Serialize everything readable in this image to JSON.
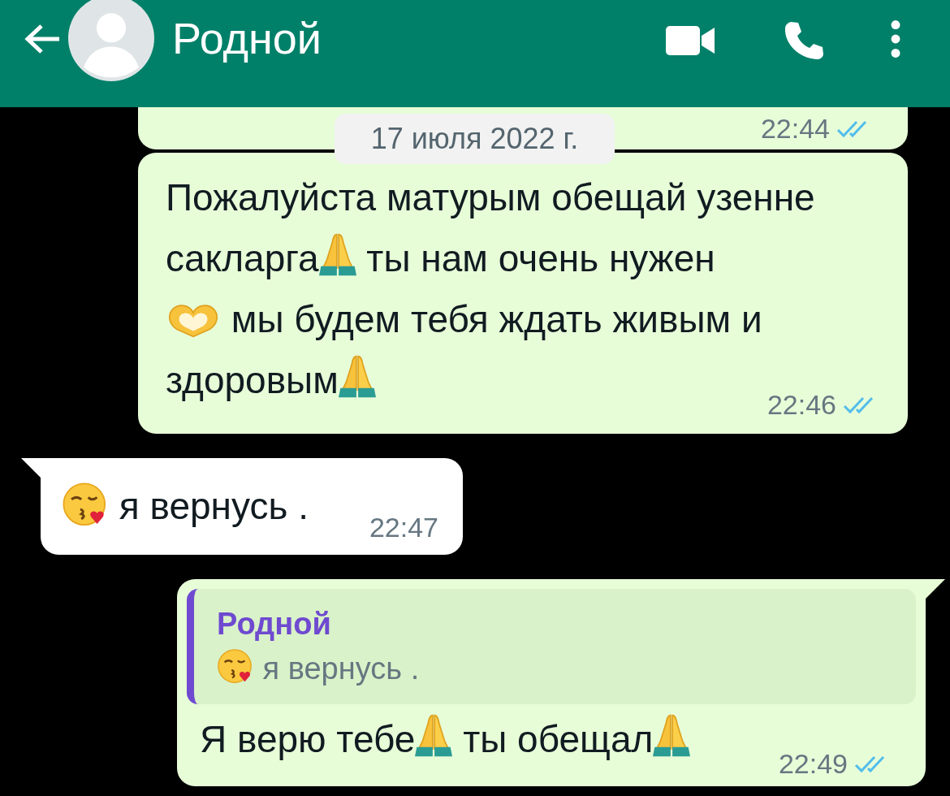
{
  "header": {
    "title": "Родной"
  },
  "date_separator": "17 июля 2022 г.",
  "messages": [
    {
      "kind": "outgoing",
      "time": "22:44",
      "read": true
    },
    {
      "kind": "outgoing",
      "time": "22:46",
      "read": true,
      "lines": [
        [
          {
            "kind": "text",
            "text": "Пожалуйста матурым обещай узенне"
          }
        ],
        [
          {
            "kind": "text",
            "text": "сакларга"
          },
          {
            "kind": "pray"
          },
          {
            "kind": "text",
            "text": " ты нам очень нужен"
          }
        ],
        [
          {
            "kind": "heart-hands"
          },
          {
            "kind": "text",
            "text": " мы будем тебя ждать живым и"
          }
        ],
        [
          {
            "kind": "text",
            "text": "здоровым"
          },
          {
            "kind": "pray"
          }
        ]
      ]
    },
    {
      "kind": "incoming",
      "time": "22:47",
      "lines": [
        [
          {
            "kind": "kiss"
          },
          {
            "kind": "text",
            "text": " я вернусь ."
          }
        ]
      ]
    },
    {
      "kind": "outgoing",
      "time": "22:49",
      "read": true,
      "reply": {
        "author": "Родной",
        "parts": [
          {
            "kind": "kiss"
          },
          {
            "kind": "text",
            "text": " я вернусь ."
          }
        ]
      },
      "lines": [
        [
          {
            "kind": "text",
            "text": "Я верю тебе"
          },
          {
            "kind": "pray"
          },
          {
            "kind": "text",
            "text": " ты обещал"
          },
          {
            "kind": "pray"
          }
        ]
      ]
    }
  ]
}
